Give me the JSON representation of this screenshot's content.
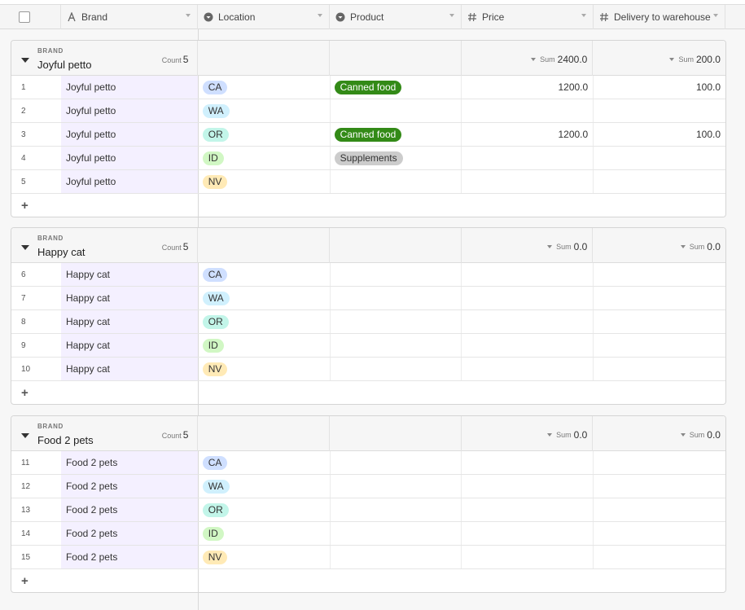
{
  "header": {
    "columns": [
      {
        "label": "Brand",
        "icon": "text-type-icon"
      },
      {
        "label": "Location",
        "icon": "single-select-icon"
      },
      {
        "label": "Product",
        "icon": "single-select-icon"
      },
      {
        "label": "Price",
        "icon": "number-icon"
      },
      {
        "label": "Delivery to warehouse",
        "icon": "number-icon"
      }
    ]
  },
  "groups": [
    {
      "label": "BRAND",
      "name": "Joyful petto",
      "count_label": "Count",
      "count": "5",
      "sum_label": "Sum",
      "price_sum": "2400.0",
      "delivery_sum": "200.0",
      "rows": [
        {
          "num": "1",
          "brand": "Joyful petto",
          "location": "CA",
          "product": "Canned food",
          "price": "1200.0",
          "delivery": "100.0"
        },
        {
          "num": "2",
          "brand": "Joyful petto",
          "location": "WA",
          "product": "",
          "price": "",
          "delivery": ""
        },
        {
          "num": "3",
          "brand": "Joyful petto",
          "location": "OR",
          "product": "Canned food",
          "price": "1200.0",
          "delivery": "100.0"
        },
        {
          "num": "4",
          "brand": "Joyful petto",
          "location": "ID",
          "product": "Supplements",
          "price": "",
          "delivery": ""
        },
        {
          "num": "5",
          "brand": "Joyful petto",
          "location": "NV",
          "product": "",
          "price": "",
          "delivery": ""
        }
      ],
      "add_label": "+"
    },
    {
      "label": "BRAND",
      "name": "Happy cat",
      "count_label": "Count",
      "count": "5",
      "sum_label": "Sum",
      "price_sum": "0.0",
      "delivery_sum": "0.0",
      "rows": [
        {
          "num": "6",
          "brand": "Happy cat",
          "location": "CA",
          "product": "",
          "price": "",
          "delivery": ""
        },
        {
          "num": "7",
          "brand": "Happy cat",
          "location": "WA",
          "product": "",
          "price": "",
          "delivery": ""
        },
        {
          "num": "8",
          "brand": "Happy cat",
          "location": "OR",
          "product": "",
          "price": "",
          "delivery": ""
        },
        {
          "num": "9",
          "brand": "Happy cat",
          "location": "ID",
          "product": "",
          "price": "",
          "delivery": ""
        },
        {
          "num": "10",
          "brand": "Happy cat",
          "location": "NV",
          "product": "",
          "price": "",
          "delivery": ""
        }
      ],
      "add_label": "+"
    },
    {
      "label": "BRAND",
      "name": "Food 2 pets",
      "count_label": "Count",
      "count": "5",
      "sum_label": "Sum",
      "price_sum": "0.0",
      "delivery_sum": "0.0",
      "rows": [
        {
          "num": "11",
          "brand": "Food 2 pets",
          "location": "CA",
          "product": "",
          "price": "",
          "delivery": ""
        },
        {
          "num": "12",
          "brand": "Food 2 pets",
          "location": "WA",
          "product": "",
          "price": "",
          "delivery": ""
        },
        {
          "num": "13",
          "brand": "Food 2 pets",
          "location": "OR",
          "product": "",
          "price": "",
          "delivery": ""
        },
        {
          "num": "14",
          "brand": "Food 2 pets",
          "location": "ID",
          "product": "",
          "price": "",
          "delivery": ""
        },
        {
          "num": "15",
          "brand": "Food 2 pets",
          "location": "NV",
          "product": "",
          "price": "",
          "delivery": ""
        }
      ],
      "add_label": "+"
    }
  ],
  "colors": {
    "canned_food": "#338a17",
    "supplements": "#cccccc",
    "brand_column_bg": "#f4f0ff",
    "location_CA": "#cfdfff",
    "location_WA": "#d0f0fd",
    "location_OR": "#c2f5e9",
    "location_ID": "#d1f7c4",
    "location_NV": "#ffeab6"
  }
}
